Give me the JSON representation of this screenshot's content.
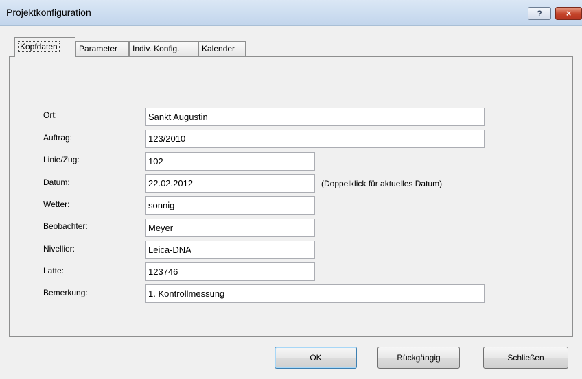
{
  "window": {
    "title": "Projektkonfiguration",
    "help_label": "?",
    "close_label": "×"
  },
  "tabs": [
    {
      "label": "Kopfdaten",
      "active": true
    },
    {
      "label": "Parameter",
      "active": false
    },
    {
      "label": "Indiv. Konfig.",
      "active": false
    },
    {
      "label": "Kalender",
      "active": false
    }
  ],
  "form": {
    "fields": [
      {
        "label": "Ort:",
        "mnemonic": "O",
        "value": "Sankt Augustin"
      },
      {
        "label": "Auftrag:",
        "mnemonic": "t",
        "value": "123/2010"
      },
      {
        "label": "Linie/Zug:",
        "mnemonic": "L",
        "value": "102"
      },
      {
        "label": "Datum:",
        "mnemonic": "D",
        "value": "22.02.2012"
      },
      {
        "label": "Wetter:",
        "mnemonic": "W",
        "value": "sonnig"
      },
      {
        "label": "Beobachter:",
        "mnemonic": "B",
        "value": "Meyer"
      },
      {
        "label": "Nivellier:",
        "mnemonic": "N",
        "value": "Leica-DNA"
      },
      {
        "label": "Latte:",
        "mnemonic": "t",
        "value": "123746"
      },
      {
        "label": "Bemerkung:",
        "mnemonic": "m",
        "value": "1. Kontrollmessung"
      }
    ],
    "date_hint": "(Doppelklick für aktuelles Datum)"
  },
  "buttons": {
    "ok": "OK",
    "undo": "Rückgängig",
    "close": "Schließen"
  }
}
